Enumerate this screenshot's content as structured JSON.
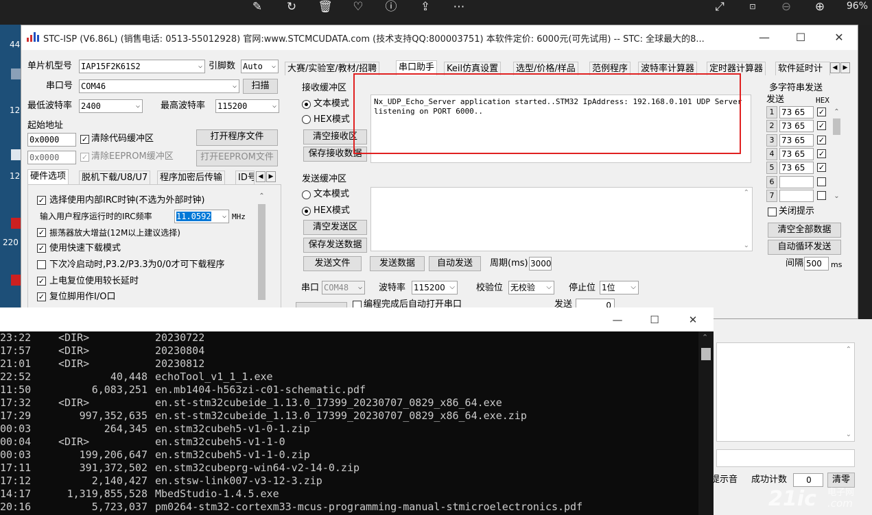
{
  "viewer": {
    "zoom": "96%"
  },
  "desktop": {
    "labels": [
      "44",
      "12",
      "12",
      "220"
    ]
  },
  "stc": {
    "title": "STC-ISP (V6.86L) (销售电话: 0513-55012928) 官网:www.STCMCUDATA.com  (技术支持QQ:800003751) 本软件定价: 6000元(可先试用) -- STC: 全球最大的8...",
    "mcu_label": "单片机型号",
    "mcu_value": "IAP15F2K61S2",
    "pins_label": "引脚数",
    "pins_value": "Auto",
    "port_label": "串口号",
    "port_value": "COM46",
    "scan_button": "扫描",
    "min_baud_label": "最低波特率",
    "min_baud_value": "2400",
    "max_baud_label": "最高波特率",
    "max_baud_value": "115200",
    "start_addr_label": "起始地址",
    "addr1": "0x0000",
    "addr2": "0x0000",
    "clear_code_buffer": "清除代码缓冲区",
    "clear_eeprom_buffer": "清除EEPROM缓冲区",
    "open_program_file": "打开程序文件",
    "open_eeprom_file": "打开EEPROM文件",
    "left_tabs": [
      "硬件选项",
      "脱机下载/U8/U7",
      "程序加密后传输",
      "ID号"
    ],
    "hw_options": {
      "internal_irc": "选择使用内部IRC时钟(不选为外部时钟)",
      "irc_freq_label": "输入用户程序运行时的IRC频率",
      "irc_freq_value": "11.0592",
      "irc_freq_unit": "MHz",
      "osc_gain": "振荡器放大增益(12M以上建议选择)",
      "fast_download": "使用快速下载模式",
      "cold_start": "下次冷启动时,P3.2/P3.3为0/0才可下载程序",
      "power_on_delay": "上电复位使用较长延时",
      "reset_io": "复位脚用作I/O口"
    },
    "right_tabs": [
      "大赛/实验室/教材/招聘",
      "串口助手",
      "Keil仿真设置",
      "选型/价格/样品",
      "范例程序",
      "波特率计算器",
      "定时器计算器",
      "软件延时计"
    ],
    "recv": {
      "group_label": "接收缓冲区",
      "text_mode": "文本模式",
      "hex_mode": "HEX模式",
      "clear_button": "清空接收区",
      "save_button": "保存接收数据",
      "content": "Nx_UDP_Echo_Server application started..STM32 IpAddress: 192.168.0.101 UDP Server listening on PORT 6000.."
    },
    "send": {
      "group_label": "发送缓冲区",
      "text_mode": "文本模式",
      "hex_mode": "HEX模式",
      "clear_button": "清空发送区",
      "save_button": "保存发送数据",
      "send_file": "发送文件",
      "send_data": "发送数据",
      "auto_send": "自动发送",
      "period_label": "周期(ms)",
      "period_value": "3000"
    },
    "serial": {
      "port_label": "串口",
      "port_value": "COM48",
      "baud_label": "波特率",
      "baud_value": "115200",
      "parity_label": "校验位",
      "parity_value": "无校验",
      "stop_label": "停止位",
      "stop_value": "1位",
      "auto_open": "编程完成后自动打开串口",
      "send_count_label": "发送",
      "send_count_value": "0"
    },
    "multi": {
      "title": "多字符串发送",
      "send_label": "发送",
      "hex_label": "HEX",
      "rows": [
        {
          "n": "1",
          "v": "73 65",
          "hex": true
        },
        {
          "n": "2",
          "v": "73 65",
          "hex": true
        },
        {
          "n": "3",
          "v": "73 65",
          "hex": true
        },
        {
          "n": "4",
          "v": "73 65",
          "hex": true
        },
        {
          "n": "5",
          "v": "73 65",
          "hex": true
        },
        {
          "n": "6",
          "v": "",
          "hex": false
        },
        {
          "n": "7",
          "v": "",
          "hex": false
        }
      ],
      "close_tips": "关闭提示",
      "clear_all": "清空全部数据",
      "auto_loop": "自动循环发送",
      "interval_label": "间隔",
      "interval_value": "500",
      "interval_unit": "ms"
    },
    "bottom": {
      "beep": "提示音",
      "success_count_label": "成功计数",
      "success_count_value": "0",
      "clear_button": "清零"
    }
  },
  "cmd": {
    "rows": [
      {
        "time": "23:22",
        "dir": "<DIR>",
        "size": "",
        "name": "20230722"
      },
      {
        "time": "17:57",
        "dir": "<DIR>",
        "size": "",
        "name": "20230804"
      },
      {
        "time": "21:01",
        "dir": "<DIR>",
        "size": "",
        "name": "20230812"
      },
      {
        "time": "22:52",
        "dir": "",
        "size": "40,448",
        "name": "echoTool_v1_1_1.exe"
      },
      {
        "time": "11:50",
        "dir": "",
        "size": "6,083,251",
        "name": "en.mb1404-h563zi-c01-schematic.pdf"
      },
      {
        "time": "17:32",
        "dir": "<DIR>",
        "size": "",
        "name": "en.st-stm32cubeide_1.13.0_17399_20230707_0829_x86_64.exe"
      },
      {
        "time": "17:29",
        "dir": "",
        "size": "997,352,635",
        "name": "en.st-stm32cubeide_1.13.0_17399_20230707_0829_x86_64.exe.zip"
      },
      {
        "time": "00:03",
        "dir": "",
        "size": "264,345",
        "name": "en.stm32cubeh5-v1-0-1.zip"
      },
      {
        "time": "00:04",
        "dir": "<DIR>",
        "size": "",
        "name": "en.stm32cubeh5-v1-1-0"
      },
      {
        "time": "00:03",
        "dir": "",
        "size": "199,206,647",
        "name": "en.stm32cubeh5-v1-1-0.zip"
      },
      {
        "time": "17:11",
        "dir": "",
        "size": "391,372,502",
        "name": "en.stm32cubeprg-win64-v2-14-0.zip"
      },
      {
        "time": "17:12",
        "dir": "",
        "size": "2,140,427",
        "name": "en.stsw-link007-v3-12-3.zip"
      },
      {
        "time": "14:17",
        "dir": "",
        "size": "1,319,855,528",
        "name": "MbedStudio-1.4.5.exe"
      },
      {
        "time": "20:16",
        "dir": "",
        "size": "5,723,037",
        "name": "pm0264-stm32-cortexm33-mcus-programming-manual-stmicroelectronics.pdf"
      }
    ]
  },
  "watermark": {
    "main": "21ic",
    "sub1": "电子网",
    "sub2": ".com"
  },
  "colors": {
    "highlight": "#e02020",
    "desktop": "#1d4f78",
    "console_bg": "#0c0c0c",
    "console_fg": "#cccccc"
  }
}
